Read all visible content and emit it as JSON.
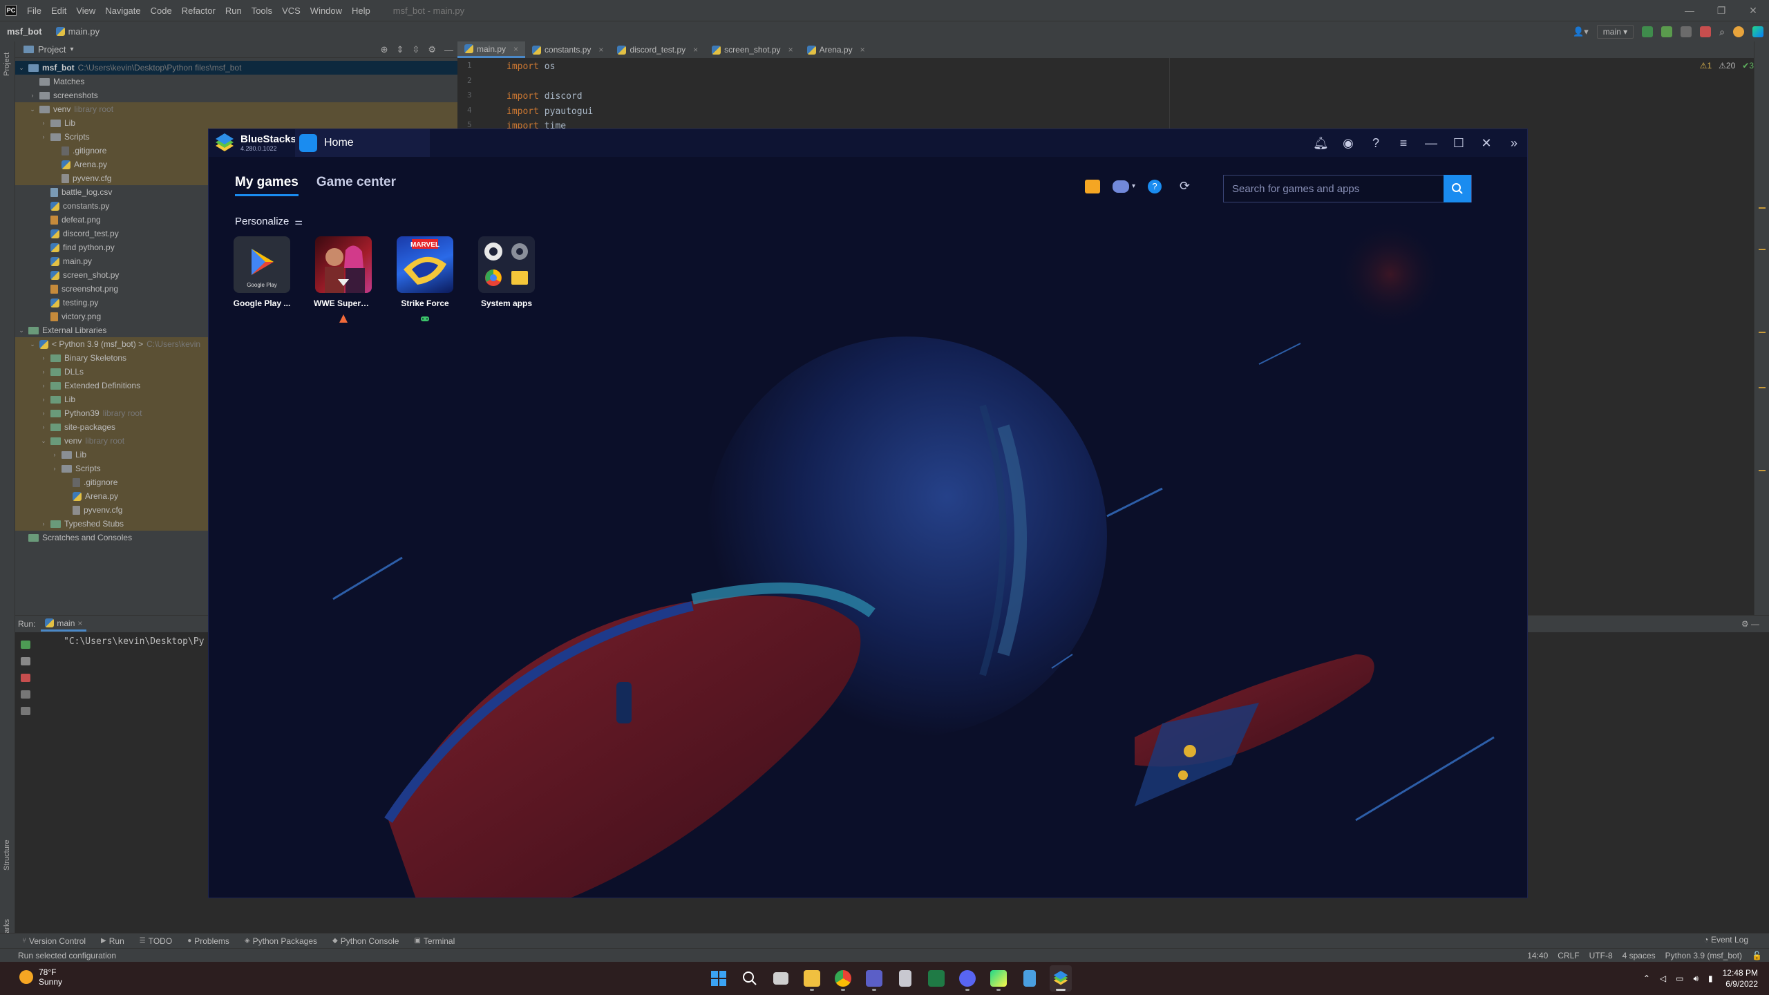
{
  "ide": {
    "menu": [
      "File",
      "Edit",
      "View",
      "Navigate",
      "Code",
      "Refactor",
      "Run",
      "Tools",
      "VCS",
      "Window",
      "Help"
    ],
    "window_title": "msf_bot - main.py",
    "breadcrumb": {
      "project": "msf_bot",
      "file": "main.py"
    },
    "branch": "main",
    "project_panel": {
      "title": "Project",
      "root": "msf_bot",
      "root_path": "C:\\Users\\kevin\\Desktop\\Python files\\msf_bot",
      "tree": [
        {
          "label": "Matches",
          "level": 1,
          "kind": "folder"
        },
        {
          "label": "screenshots",
          "level": 1,
          "kind": "folder",
          "arrow": "›"
        },
        {
          "label": "venv",
          "suffix": "library root",
          "level": 1,
          "kind": "folder",
          "arrow": "⌄",
          "hl": true
        },
        {
          "label": "Lib",
          "level": 2,
          "kind": "folder",
          "arrow": "›",
          "hl": true
        },
        {
          "label": "Scripts",
          "level": 2,
          "kind": "folder",
          "arrow": "›",
          "hl": true
        },
        {
          "label": ".gitignore",
          "level": 3,
          "kind": "git",
          "hl": true
        },
        {
          "label": "Arena.py",
          "level": 3,
          "kind": "py",
          "hl": true
        },
        {
          "label": "pyvenv.cfg",
          "level": 3,
          "kind": "cfg",
          "hl": true
        },
        {
          "label": "battle_log.csv",
          "level": 2,
          "kind": "csv"
        },
        {
          "label": "constants.py",
          "level": 2,
          "kind": "py"
        },
        {
          "label": "defeat.png",
          "level": 2,
          "kind": "png"
        },
        {
          "label": "discord_test.py",
          "level": 2,
          "kind": "py"
        },
        {
          "label": "find python.py",
          "level": 2,
          "kind": "py"
        },
        {
          "label": "main.py",
          "level": 2,
          "kind": "py"
        },
        {
          "label": "screen_shot.py",
          "level": 2,
          "kind": "py"
        },
        {
          "label": "screenshot.png",
          "level": 2,
          "kind": "png"
        },
        {
          "label": "testing.py",
          "level": 2,
          "kind": "py"
        },
        {
          "label": "victory.png",
          "level": 2,
          "kind": "png"
        },
        {
          "label": "External Libraries",
          "level": 0,
          "kind": "ext",
          "arrow": "⌄"
        },
        {
          "label": "< Python 3.9 (msf_bot) >",
          "suffix": "C:\\Users\\kevin",
          "level": 1,
          "kind": "py",
          "arrow": "⌄",
          "hl": true
        },
        {
          "label": "Binary Skeletons",
          "level": 2,
          "kind": "ext",
          "arrow": "›",
          "hl": true
        },
        {
          "label": "DLLs",
          "level": 2,
          "kind": "ext",
          "arrow": "›",
          "hl": true
        },
        {
          "label": "Extended Definitions",
          "level": 2,
          "kind": "ext",
          "arrow": "›",
          "hl": true
        },
        {
          "label": "Lib",
          "level": 2,
          "kind": "ext",
          "arrow": "›",
          "hl": true
        },
        {
          "label": "Python39",
          "suffix": "library root",
          "level": 2,
          "kind": "ext",
          "arrow": "›",
          "hl": true
        },
        {
          "label": "site-packages",
          "level": 2,
          "kind": "ext",
          "arrow": "›",
          "hl": true
        },
        {
          "label": "venv",
          "suffix": "library root",
          "level": 2,
          "kind": "ext",
          "arrow": "⌄",
          "hl": true
        },
        {
          "label": "Lib",
          "level": 3,
          "kind": "folder",
          "arrow": "›",
          "hl": true
        },
        {
          "label": "Scripts",
          "level": 3,
          "kind": "folder",
          "arrow": "›",
          "hl": true
        },
        {
          "label": ".gitignore",
          "level": 4,
          "kind": "git",
          "hl": true
        },
        {
          "label": "Arena.py",
          "level": 4,
          "kind": "py",
          "hl": true
        },
        {
          "label": "pyvenv.cfg",
          "level": 4,
          "kind": "cfg",
          "hl": true
        },
        {
          "label": "Typeshed Stubs",
          "level": 2,
          "kind": "ext",
          "arrow": "›",
          "hl": true
        },
        {
          "label": "Scratches and Consoles",
          "level": 0,
          "kind": "ext"
        }
      ]
    },
    "editor_tabs": [
      "main.py",
      "constants.py",
      "discord_test.py",
      "screen_shot.py",
      "Arena.py"
    ],
    "code_lines": [
      {
        "n": "1",
        "kw": "import",
        "rest": " os"
      },
      {
        "n": "2",
        "kw": "",
        "rest": ""
      },
      {
        "n": "3",
        "kw": "import",
        "rest": " discord"
      },
      {
        "n": "4",
        "kw": "import",
        "rest": " pyautogui"
      },
      {
        "n": "5",
        "kw": "import",
        "rest": " time"
      }
    ],
    "inspections": {
      "warn1": "1",
      "warn2": "20",
      "ok": "3"
    },
    "run": {
      "label": "Run:",
      "config": "main",
      "output": "\"C:\\Users\\kevin\\Desktop\\Py"
    },
    "left_strip": {
      "project": "Project",
      "structure": "Structure",
      "bookmarks": "Bookmarks"
    },
    "bottom_tabs": [
      "Version Control",
      "Run",
      "TODO",
      "Problems",
      "Python Packages",
      "Python Console",
      "Terminal"
    ],
    "event_log": "Event Log",
    "status": {
      "message": "Run selected configuration",
      "position": "14:40",
      "line_sep": "CRLF",
      "encoding": "UTF-8",
      "indent": "4 spaces",
      "interpreter": "Python 3.9 (msf_bot)"
    }
  },
  "bluestacks": {
    "brand": "BlueStacks",
    "version": "4.280.0.1022",
    "home_tab": "Home",
    "nav": [
      "My games",
      "Game center"
    ],
    "search_placeholder": "Search for games and apps",
    "personalize": "Personalize",
    "apps": [
      {
        "label": "Google Play ...",
        "badge": ""
      },
      {
        "label": "WWE SuperC...",
        "badge": "warning"
      },
      {
        "label": "Strike Force",
        "badge": "gamepad"
      },
      {
        "label": "System apps",
        "badge": ""
      }
    ],
    "google_play_caption": "Google Play",
    "marvel_text": "MARVEL"
  },
  "taskbar": {
    "weather_temp": "78°F",
    "weather_desc": "Sunny",
    "time": "12:48 PM",
    "date": "6/9/2022"
  }
}
